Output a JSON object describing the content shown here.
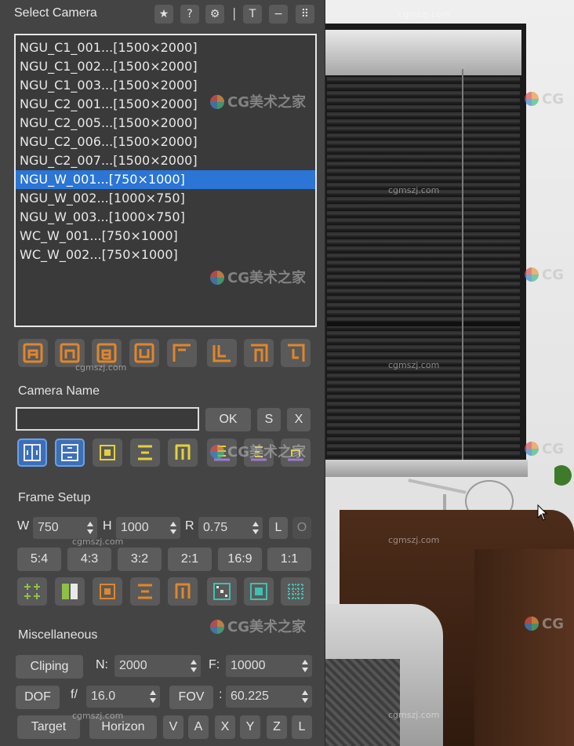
{
  "panel": {
    "title": "Select Camera",
    "toolbar": {
      "star": "★",
      "help": "?",
      "settings": "⚙",
      "separator": "|",
      "t": "T",
      "minimize": "−",
      "grip": "⠿"
    }
  },
  "camera_list": {
    "items": [
      "NGU_C1_001...[1500×2000]",
      "NGU_C1_002...[1500×2000]",
      "NGU_C1_003...[1500×2000]",
      "NGU_C2_001...[1500×2000]",
      "NGU_C2_005...[1500×2000]",
      "NGU_C2_006...[1500×2000]",
      "NGU_C2_007...[1500×2000]",
      "NGU_W_001...[750×1000]",
      "NGU_W_002...[1000×750]",
      "NGU_W_003...[1000×750]",
      "WC_W_001...[750×1000]",
      "WC_W_002...[750×1000]"
    ],
    "selected_index": 7
  },
  "camera_name": {
    "section_label": "Camera Name",
    "value": "",
    "ok_label": "OK",
    "s_label": "S",
    "x_label": "X"
  },
  "frame_setup": {
    "section_label": "Frame Setup",
    "w_label": "W",
    "w_value": "750",
    "h_label": "H",
    "h_value": "1000",
    "r_label": "R",
    "r_value": "0.75",
    "l_label": "L",
    "o_label": "O",
    "ratios": [
      "5:4",
      "4:3",
      "3:2",
      "2:1",
      "16:9",
      "1:1"
    ]
  },
  "misc": {
    "section_label": "Miscellaneous",
    "cliping_label": "Cliping",
    "n_label": "N:",
    "n_value": "2000",
    "f_label": "F:",
    "f_value": "10000",
    "dof_label": "DOF",
    "fstop_label": "f/",
    "fstop_value": "16.0",
    "fov_label": "FOV",
    "fov_colon": ":",
    "fov_value": "60.225",
    "target_label": "Target",
    "horizon_label": "Horizon",
    "axis_buttons": [
      "V",
      "A",
      "X",
      "Y",
      "Z",
      "L"
    ]
  },
  "watermarks": {
    "small": "cgmszj.com",
    "logo": "CG美术之家",
    "logo_short": "CG"
  },
  "colors": {
    "panel_bg": "#444444",
    "selection": "#2a75d6",
    "icon_orange": "#e0862c",
    "icon_yellow": "#e2d23a",
    "icon_purple": "#9b7ad0",
    "icon_green": "#8fc04a",
    "icon_teal": "#3fc0b0"
  }
}
